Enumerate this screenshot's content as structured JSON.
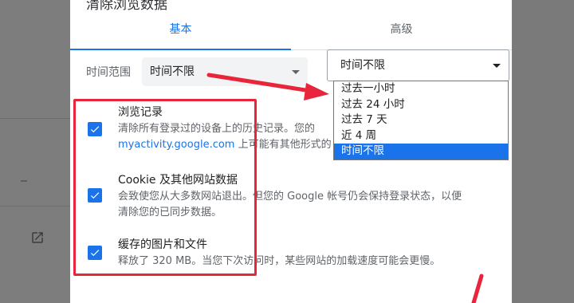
{
  "dialog": {
    "title": "清除浏览数据",
    "tabs": [
      {
        "label": "基本",
        "active": true
      },
      {
        "label": "高级",
        "active": false
      }
    ],
    "time_range": {
      "label": "时间范围",
      "value": "时间不限"
    },
    "items": [
      {
        "title": "浏览记录",
        "checked": true,
        "desc_line1": "清除所有登录过的设备上的历史记录。您的",
        "desc_link": "myactivity.google.com",
        "desc_line2_rest": " 上可能有其他形式的"
      },
      {
        "title": "Cookie 及其他网站数据",
        "checked": true,
        "desc_line1": "会致使您从大多数网站退出。但您的 Google 帐号仍会保持登录状态，以便",
        "desc_line2": "清除您的已同步数据。"
      },
      {
        "title": "缓存的图片和文件",
        "checked": true,
        "desc_line1": "释放了 320 MB。当您下次访问时，某些网站的加载速度可能会更慢。"
      }
    ]
  },
  "time_dropdown": {
    "value": "时间不限",
    "options": [
      "过去一小时",
      "过去 24 小时",
      "过去 7 天",
      "近 4 周",
      "时间不限"
    ],
    "selected_index": 4
  },
  "colors": {
    "accent": "#1a73e8",
    "annotation_red": "#e8253a"
  },
  "icons": {
    "external_link": "open-in-new-icon",
    "checkbox": "checkmark-icon"
  }
}
